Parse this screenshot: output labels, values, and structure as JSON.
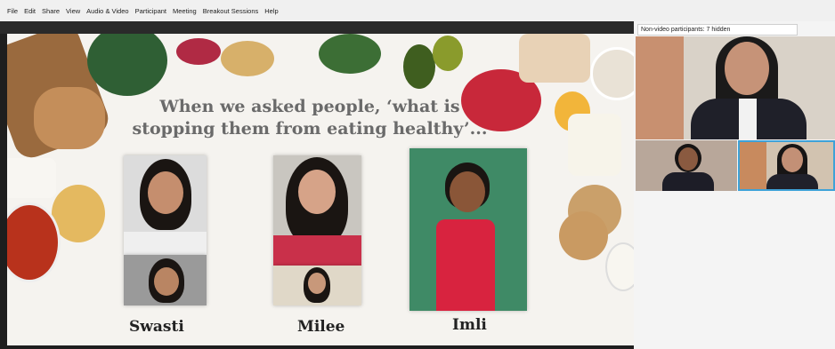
{
  "menubar": {
    "items": [
      "File",
      "Edit",
      "Share",
      "View",
      "Audio & Video",
      "Participant",
      "Meeting",
      "Breakout Sessions",
      "Help"
    ]
  },
  "slide": {
    "title_line1": "When we asked people, ‘what is",
    "title_line2": "stopping them from eating healthy’...",
    "names": [
      "Swasti",
      "Milee",
      "Imli"
    ]
  },
  "participants": {
    "nonvideo_label": "Non-video participants: 7 hidden"
  },
  "colors": {
    "active_speaker_border": "#3ea2d8",
    "slide_background": "#f5f3ef"
  }
}
